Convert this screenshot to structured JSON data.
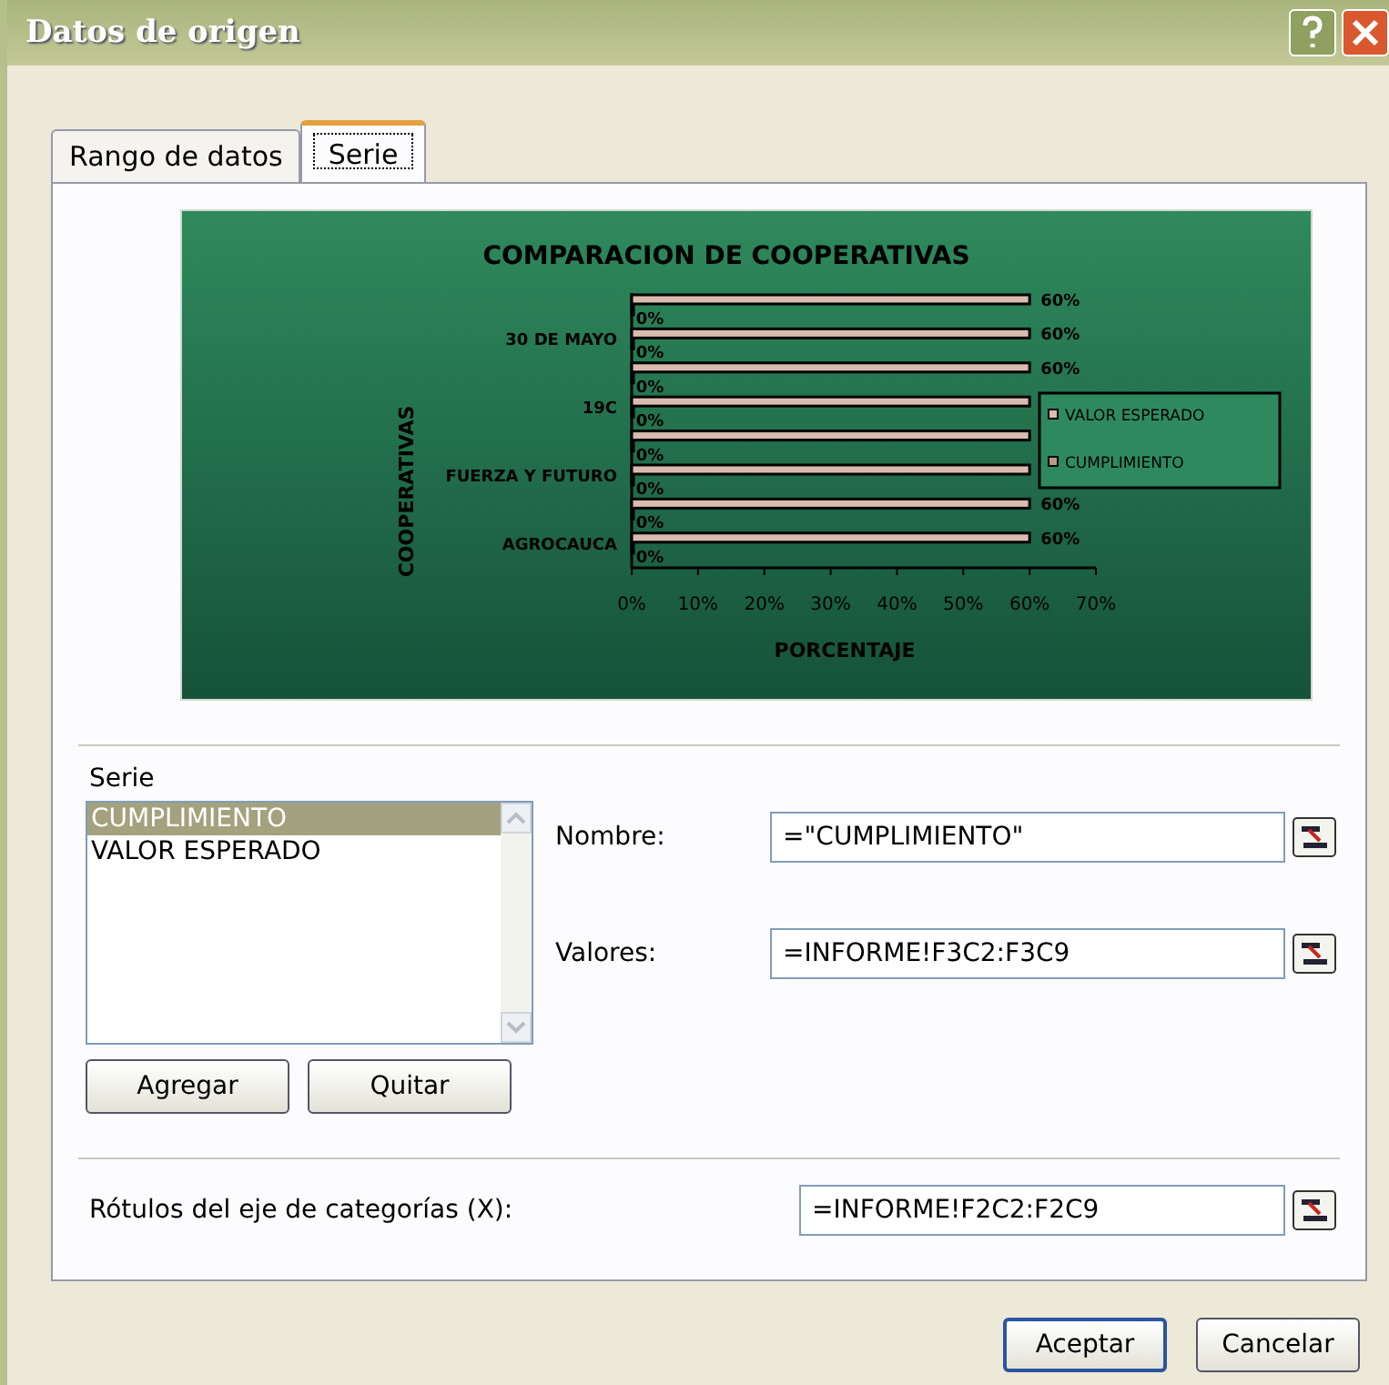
{
  "window": {
    "title": "Datos de origen"
  },
  "tabs": [
    {
      "label": "Rango de datos",
      "selected": false
    },
    {
      "label": "Serie",
      "selected": true
    }
  ],
  "chart_data": {
    "type": "bar",
    "orientation": "horizontal",
    "title": "COMPARACION DE COOPERATIVAS",
    "xlabel": "PORCENTAJE",
    "ylabel": "COOPERATIVAS",
    "categories": [
      null,
      "30 DE MAYO",
      null,
      "19C",
      null,
      "FUERZA Y FUTURO",
      null,
      "AGROCAUCA"
    ],
    "series": [
      {
        "name": "VALOR ESPERADO",
        "color": "#d8bcae",
        "values": [
          0.6,
          0.6,
          0.6,
          0.6,
          0.6,
          0.6,
          0.6,
          0.6
        ]
      },
      {
        "name": "CUMPLIMIENTO",
        "color": "#b89888",
        "values": [
          0,
          0,
          0,
          0,
          0,
          0,
          0,
          0
        ]
      }
    ],
    "xlim": [
      0,
      0.7
    ],
    "xticks": [
      {
        "value": 0,
        "label": "0%"
      },
      {
        "value": 0.1,
        "label": "10%"
      },
      {
        "value": 0.2,
        "label": "20%"
      },
      {
        "value": 0.3,
        "label": "30%"
      },
      {
        "value": 0.4,
        "label": "40%"
      },
      {
        "value": 0.5,
        "label": "50%"
      },
      {
        "value": 0.6,
        "label": "60%"
      },
      {
        "value": 0.7,
        "label": "70%"
      }
    ],
    "value_labels": [
      "60%",
      "0%"
    ],
    "legend": true
  },
  "series_list": {
    "label": "Serie",
    "items": [
      {
        "label": "CUMPLIMIENTO",
        "selected": true
      },
      {
        "label": "VALOR ESPERADO",
        "selected": false
      }
    ]
  },
  "fields": [
    {
      "label": "Nombre:",
      "value": "=\"CUMPLIMIENTO\""
    },
    {
      "label": "Valores:",
      "value": "=INFORME!F3C2:F3C9"
    }
  ],
  "list_buttons": [
    "Agregar",
    "Quitar"
  ],
  "category_field": {
    "label": "Rótulos del eje de categorías (X):",
    "value": "=INFORME!F2C2:F2C9"
  },
  "buttons": [
    "Aceptar",
    "Cancelar"
  ]
}
